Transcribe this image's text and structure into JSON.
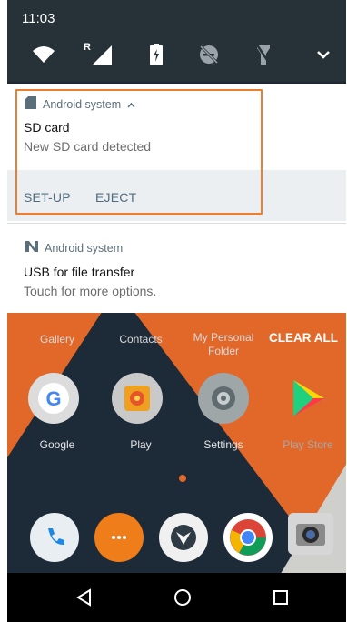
{
  "status": {
    "time": "11:03"
  },
  "quick_settings": {
    "icons": [
      "wifi-icon",
      "signal-roaming-icon",
      "battery-saver-icon",
      "do-not-disturb-off-icon",
      "flashlight-off-icon",
      "expand-chevron-icon"
    ],
    "roaming_marker": "R"
  },
  "notifications": [
    {
      "app": "Android system",
      "title": "SD card",
      "body": "New SD card detected",
      "actions": [
        "SET-UP",
        "EJECT"
      ],
      "icon": "sd-card-icon"
    },
    {
      "app": "Android system",
      "title": "USB for file transfer",
      "body": "Touch for more options.",
      "icon": "android-n-icon"
    }
  ],
  "recents": {
    "labels": [
      "Gallery",
      "Contacts",
      "My Personal Folder"
    ],
    "clear_all": "CLEAR ALL"
  },
  "home_apps": [
    "Google",
    "Play",
    "Settings",
    "Play Store"
  ],
  "dock": [
    "phone-icon",
    "messages-icon",
    "wildfire-icon",
    "chrome-icon",
    "camera-icon"
  ],
  "nav": [
    "back-icon",
    "home-icon",
    "recents-icon"
  ],
  "colors": {
    "accent_highlight": "#ee7d2f",
    "qs_bg": "#263238",
    "action_text": "#506c80",
    "wallpaper_orange": "#e2682a"
  }
}
